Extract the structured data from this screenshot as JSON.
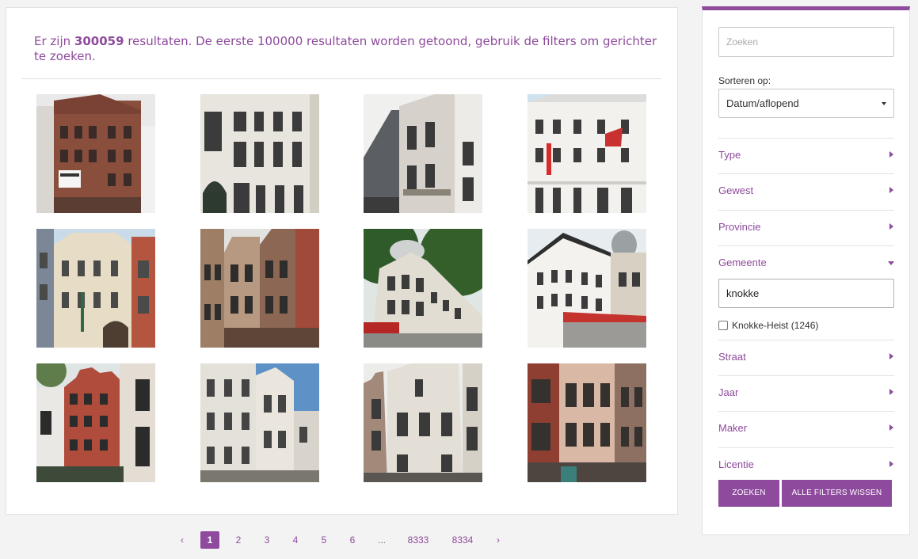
{
  "results": {
    "prefix": "Er zijn",
    "count": "300059",
    "suffix": "resultaten. De eerste 100000 resultaten worden getoond, gebruik de filters om gerichter te zoeken."
  },
  "pagination": {
    "prev": "‹",
    "pages": [
      "1",
      "2",
      "3",
      "4",
      "5",
      "6",
      "...",
      "8333",
      "8334"
    ],
    "active": "1",
    "next": "›"
  },
  "filters": {
    "search_placeholder": "Zoeken",
    "sort_label": "Sorteren op:",
    "sort_value": "Datum/aflopend",
    "facets": {
      "type": "Type",
      "gewest": "Gewest",
      "provincie": "Provincie",
      "gemeente": "Gemeente",
      "straat": "Straat",
      "jaar": "Jaar",
      "maker": "Maker",
      "licentie": "Licentie"
    },
    "gemeente_value": "knokke",
    "gemeente_option": "Knokke-Heist (1246)",
    "search_button": "Zoeken",
    "clear_button": "Alle filters wissen"
  },
  "colors": {
    "accent": "#8e4a9c"
  }
}
